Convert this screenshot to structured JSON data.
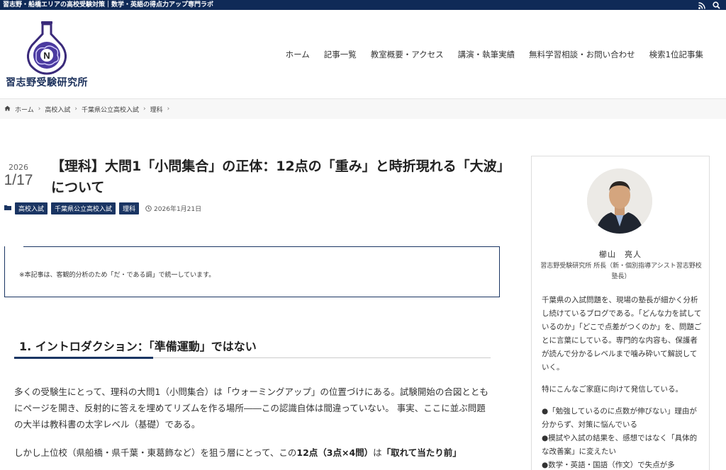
{
  "topbar": {
    "tagline": "習志野・船橋エリアの高校受験対策｜数学・英語の得点力アップ専門ラボ",
    "icons": [
      "rss-icon",
      "search-icon"
    ]
  },
  "header": {
    "logo_letter": "N",
    "site_name": "習志野受験研究所",
    "nav": [
      "ホーム",
      "記事一覧",
      "教室概要・アクセス",
      "講演・執筆実績",
      "無料学習相談・お問い合わせ",
      "検索1位記事集"
    ]
  },
  "breadcrumb": [
    "ホーム",
    "高校入試",
    "千葉県公立高校入試",
    "理科"
  ],
  "post": {
    "date_year": "2026",
    "date_md": "1/17",
    "title": "【理科】大問1「小問集合」の正体：12点の「重み」と時折現れる「大波」について",
    "tags": [
      "高校入試",
      "千葉県公立高校入試",
      "理科"
    ],
    "published": "2026年1月21日",
    "notice": "※本記事は、客観的分析のため「だ・である調」で統一しています。",
    "h2": "1. イントロダクション：「準備運動」ではない",
    "para1": "多くの受験生にとって、理科の大問1（小問集合）は「ウォーミングアップ」の位置づけにある。試験開始の合図とともにページを開き、反射的に答えを埋めてリズムを作る場所――この認識自体は間違っていない。 事実、ここに並ぶ問題の大半は教科書の太字レベル（基礎）である。",
    "para2_pre": "しかし上位校（県船橋・県千葉・東葛飾など）を狙う層にとって、この",
    "para2_bold1": "12点（3点×4問）",
    "para2_mid": "は",
    "para2_bold2": "「取れて当たり前」",
    "para2_post": ""
  },
  "sidebar": {
    "author_name": "櫛山　亮人",
    "author_role": "習志野受験研究所 所長（新・個別指導アシスト習志野校 塾長）",
    "intro": "千葉県の入試問題を、現場の塾長が細かく分析し続けているブログである。「どんな力を試しているのか」「どこで点差がつくのか」を、問題ごとに言葉にしている。専門的な内容も、保護者が読んで分かるレベルまで噛み砕いて解説していく。",
    "lead": "特にこんなご家庭に向けて発信している。",
    "bullets": [
      "●「勉強しているのに点数が伸びない」理由が分からず、対策に悩んでいる",
      "●模試や入試の結果を、感想ではなく「具体的な改善案」に変えたい",
      "●数学・英語・国語（作文）で失点が多"
    ]
  },
  "colors": {
    "navy": "#0f2a57",
    "tag_bg": "#1a3563"
  }
}
